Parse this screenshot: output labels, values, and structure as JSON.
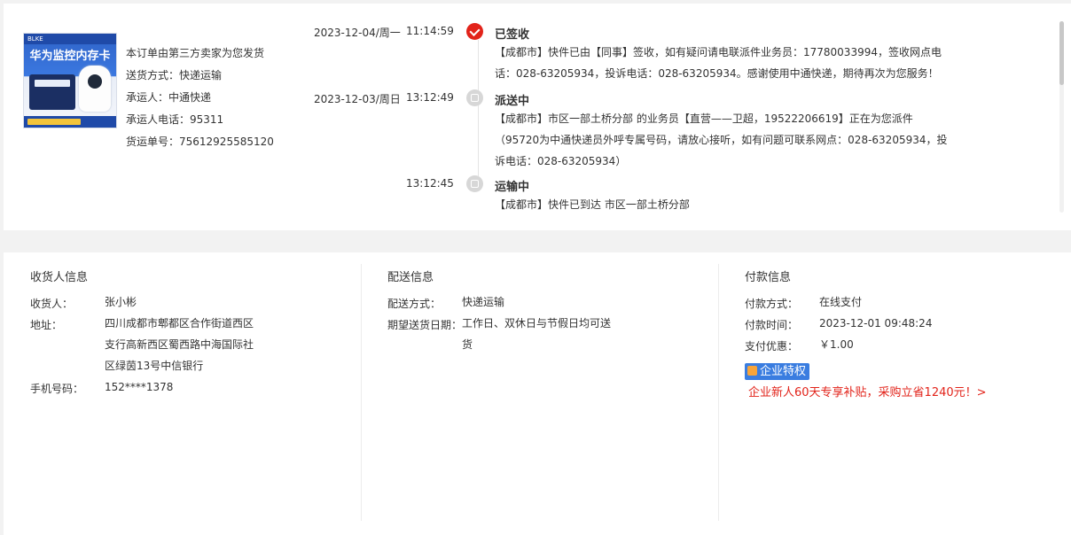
{
  "product": {
    "thumb_header": "BLKE",
    "thumb_title": "华为监控内存卡",
    "info": [
      "本订单由第三方卖家为您发货",
      "送货方式：快递运输",
      "承运人：中通快递",
      "承运人电话：95311",
      "货运单号：75612925585120"
    ]
  },
  "timeline": [
    {
      "date": "2023-12-04/周一",
      "time": "11:14:59",
      "status": "已签收",
      "icon": "signed-check-icon",
      "desc": "【成都市】快件已由【同事】签收，如有疑问请电联派件业务员：17780033994，签收网点电话：028-63205934，投诉电话：028-63205934。感谢使用中通快递，期待再次为您服务！"
    },
    {
      "date": "2023-12-03/周日",
      "time": "13:12:49",
      "status": "派送中",
      "icon": "delivery-icon",
      "desc": "【成都市】市区一部土桥分部 的业务员【直营——卫超，19522206619】正在为您派件（95720为中通快递员外呼专属号码，请放心接听，如有问题可联系网点：028-63205934，投诉电话：028-63205934）"
    },
    {
      "date": "",
      "time": "13:12:45",
      "status": "运输中",
      "icon": "transit-icon",
      "desc": "【成都市】快件已到达 市区一部土桥分部"
    }
  ],
  "consignee": {
    "title": "收货人信息",
    "name_label": "收货人：",
    "name": "张小彬",
    "address_label": "地址：",
    "address": "四川成都市郫都区合作街道西区支行高新西区蜀西路中海国际社区绿茵13号中信银行",
    "phone_label": "手机号码：",
    "phone": "152****1378"
  },
  "delivery": {
    "title": "配送信息",
    "method_label": "配送方式：",
    "method": "快递运输",
    "date_label": "期望送货日期：",
    "date": "工作日、双休日与节假日均可送货"
  },
  "payment": {
    "title": "付款信息",
    "method_label": "付款方式：",
    "method": "在线支付",
    "time_label": "付款时间：",
    "time": "2023-12-01 09:48:24",
    "discount_label": "支付优惠：",
    "discount": "￥1.00",
    "badge": "企业特权",
    "promo": "企业新人60天专享补贴，采购立省1240元！>"
  },
  "colors": {
    "accent_red": "#e2231a",
    "badge_blue": "#3a7de0"
  }
}
